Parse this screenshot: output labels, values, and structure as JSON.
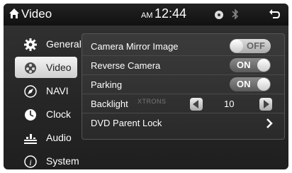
{
  "header": {
    "title": "Video",
    "ampm": "AM",
    "time": "12:44",
    "home_icon": "home-icon",
    "disc_icon": "disc-icon",
    "bluetooth_icon": "bluetooth-icon",
    "back_icon": "back-icon"
  },
  "menu": {
    "items": [
      {
        "label": "General",
        "icon": "gear-icon"
      },
      {
        "label": "Video",
        "icon": "video-icon",
        "active": true
      },
      {
        "label": "NAVI",
        "icon": "compass-icon"
      },
      {
        "label": "Clock",
        "icon": "clock-icon"
      },
      {
        "label": "Audio",
        "icon": "equalizer-icon"
      },
      {
        "label": "System",
        "icon": "info-icon"
      }
    ]
  },
  "settings": {
    "camera_mirror_image": {
      "label": "Camera Mirror Image",
      "state": "OFF"
    },
    "reverse_camera": {
      "label": "Reverse Camera",
      "state": "ON"
    },
    "parking": {
      "label": "Parking",
      "state": "ON"
    },
    "backlight": {
      "label": "Backlight",
      "value": "10",
      "watermark": "XTRONS"
    },
    "dvd_parent_lock": {
      "label": "DVD Parent Lock"
    }
  }
}
